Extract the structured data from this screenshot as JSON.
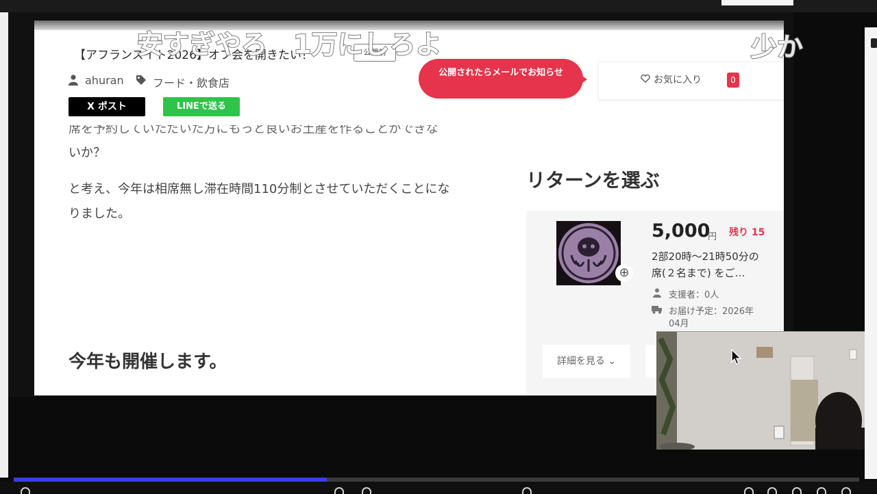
{
  "overlay_comments": [
    "安すぎやろ　1万にしろよ",
    "少か"
  ],
  "project": {
    "title": "【アフランスイト2026】オフ会を開きたい！",
    "status_badge": "公開前",
    "author": "ahuran",
    "category": "フード・飲食店"
  },
  "share": {
    "x_post": "X ポスト",
    "line_send": "LINEで送る"
  },
  "notify_button": "公開されたらメールでお知らせ",
  "favorite": {
    "label": "お気に入り",
    "count": "0"
  },
  "body": {
    "cut_line": "席を予約していただいた方にもっと良いお土産を作ることができな",
    "line_1": "いか？",
    "line_2": "と考え、今年は相席無し滞在時間110分制とさせていただくことにな",
    "line_3": "りました。",
    "section_heading": "今年も開催します。"
  },
  "returns": {
    "heading": "リターンを選ぶ",
    "items": [
      {
        "price": "5,000",
        "currency": "円",
        "remaining": "残り 15",
        "desc_line_1": "2部20時～21時50分の",
        "desc_line_2": "席(２名まで) をご…",
        "supporters": "支援者：0人",
        "delivery_line_1": "お届け予定：2026年",
        "delivery_line_2": "04月",
        "details_label": "詳細を見る ⌄"
      }
    ]
  },
  "player": {
    "progress": 0.37
  },
  "colors": {
    "accent_red": "#e5344b",
    "line_green": "#2ec449",
    "progress_blue": "#3a3ef0"
  },
  "icons": [
    "user-icon",
    "tag-icon",
    "heart-icon",
    "expand-icon",
    "truck-icon",
    "chevron-down-icon",
    "mouse-cursor-icon"
  ]
}
